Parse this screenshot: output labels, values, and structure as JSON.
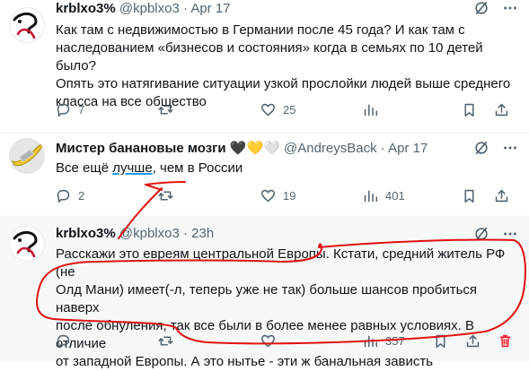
{
  "tweets": [
    {
      "name": "krblxo3%",
      "handle": "@kpblxo3",
      "date": "Apr 17",
      "body": [
        "Как там с недвижимостью в Германии после 45 года? И как там с",
        "наследованием «бизнесов и состояния» когда в семьях по 10 детей было?",
        "Опять это натягивание ситуации узкой прослойки людей выше среднего",
        "класса на все общество"
      ],
      "replies": "7",
      "retweets": "",
      "likes": "25",
      "views": ""
    },
    {
      "name": "Мистер банановые мозги",
      "hearts": "🖤💛🤍",
      "handle": "@AndreysBack",
      "date": "Apr 17",
      "body_pre": "Все ещё ",
      "body_underlined": "лучше",
      "body_post": ", чем в России",
      "replies": "2",
      "retweets": "",
      "likes": "19",
      "views": "401"
    },
    {
      "name": "krblxo3%",
      "handle": "@kpblxo3",
      "date": "23h",
      "body": [
        "Расскажи это евреям центральной Европы. Кстати, средний житель РФ (не",
        "Олд Мани) имеет(-л, теперь уже не так) больше шансов пробиться наверх",
        "после обнуления, так все были в более менее равных условиях. В отличие",
        "от западной Европы. А это нытье - эти ж банальная зависть"
      ],
      "replies": "",
      "retweets": "",
      "likes": "",
      "views": "357"
    }
  ],
  "sep": "·",
  "colors": {
    "text": "#0f1419",
    "secondary": "#536471",
    "annotation": "#e0100f",
    "underline": "#1d9bf0",
    "delete": "#f4212e"
  },
  "icons": [
    "reply-icon",
    "retweet-icon",
    "like-icon",
    "views-icon",
    "bookmark-icon",
    "share-icon",
    "grok-icon",
    "more-icon",
    "delete-icon"
  ]
}
